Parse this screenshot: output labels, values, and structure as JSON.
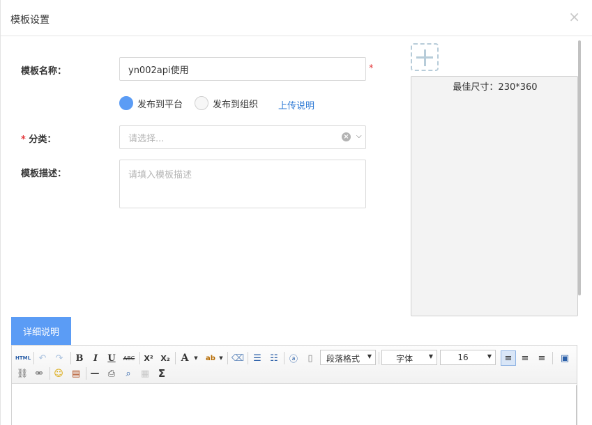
{
  "dialog": {
    "title": "模板设置",
    "close": "×"
  },
  "form": {
    "name_label": "模板名称：",
    "name_value": "yn002api使用",
    "required_mark": "*",
    "radio_platform": "发布到平台",
    "radio_org": "发布到组织",
    "upload_link": "上传说明",
    "category_label": "分类：",
    "category_placeholder": "请选择...",
    "desc_label": "模板描述：",
    "desc_placeholder": "请填入模板描述"
  },
  "preview": {
    "size_text": "最佳尺寸：230*360"
  },
  "tab": {
    "detail_label": "详细说明"
  },
  "toolbar": {
    "html": "HTML",
    "bold": "B",
    "italic": "I",
    "underline": "U",
    "strike": "ABC",
    "sup": "X²",
    "sub": "X₂",
    "fontcolor": "A",
    "paragraph": "段落格式",
    "font": "字体",
    "size": "16",
    "sigma": "Σ"
  }
}
